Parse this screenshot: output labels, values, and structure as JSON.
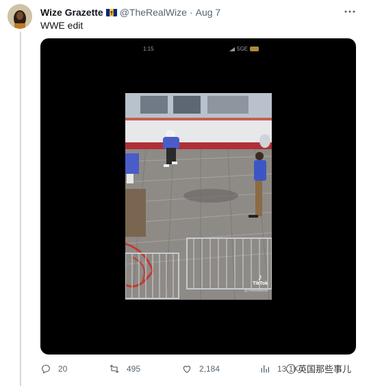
{
  "author": {
    "name": "Wize Grazette",
    "handle": "@TheRealWize",
    "separator": "·",
    "date": "Aug 7"
  },
  "tweet": {
    "text": "WWE edit"
  },
  "video": {
    "status_time": "1:15",
    "status_network": "5GE",
    "watermark_brand": "TikTok",
    "watermark_user": "@TheRealWize"
  },
  "actions": {
    "replies": "20",
    "retweets": "495",
    "likes": "2,184",
    "views": "13.1K"
  },
  "overlay_watermark": "英国那些事儿",
  "icons": {
    "more": "more-horizontal-icon",
    "reply": "reply-icon",
    "retweet": "retweet-icon",
    "like": "heart-icon",
    "views": "bar-chart-icon",
    "flag": "barbados-flag-icon"
  }
}
